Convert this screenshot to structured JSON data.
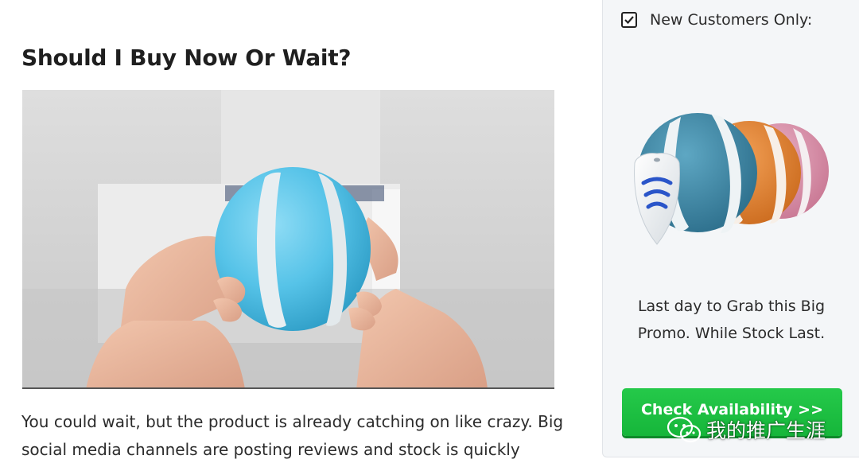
{
  "article": {
    "heading": "Should I Buy Now Or Wait?",
    "body_line1": "You could wait, but the product is already catching on like crazy. Big",
    "body_line2": "social media channels are posting reviews and stock is quickly"
  },
  "sidebar": {
    "checkbox_label": "New Customers Only:",
    "checkbox_checked": true,
    "promo_line1": "Last day to Grab this Big",
    "promo_line2": "Promo. While Stock Last.",
    "cta_label": "Check Availability >>"
  },
  "watermark": {
    "text": "我的推广生涯",
    "icon": "wechat-icon"
  },
  "colors": {
    "cta_green": "#1cbf41",
    "sidebar_bg": "#f4f6f8",
    "ball_blue": "#5cc7ea",
    "product_teal": "#3e8aa8",
    "product_orange": "#e07f2c",
    "product_pink": "#d88aa5"
  }
}
